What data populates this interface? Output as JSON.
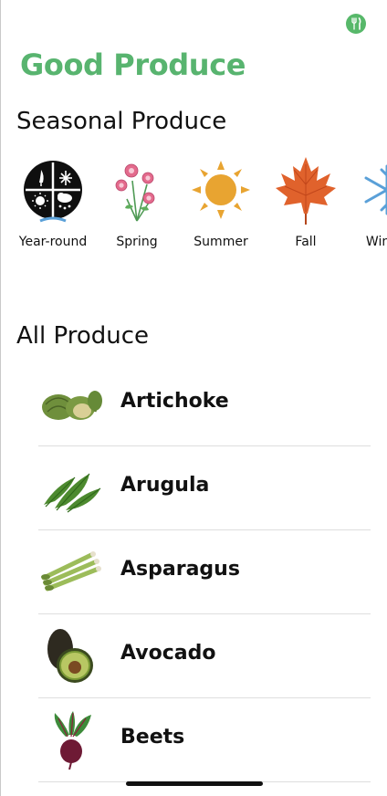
{
  "app": {
    "title": "Good Produce"
  },
  "top_icon": {
    "name": "fork-knife-icon"
  },
  "seasonal": {
    "title": "Seasonal Produce",
    "items": [
      {
        "label": "Year-round",
        "icon": "four-seasons-icon"
      },
      {
        "label": "Spring",
        "icon": "flowers-icon"
      },
      {
        "label": "Summer",
        "icon": "sun-icon"
      },
      {
        "label": "Fall",
        "icon": "maple-leaf-icon"
      },
      {
        "label": "Winter",
        "icon": "snowflake-icon"
      }
    ]
  },
  "all_produce": {
    "title": "All Produce",
    "items": [
      {
        "name": "Artichoke",
        "image": "artichoke-image"
      },
      {
        "name": "Arugula",
        "image": "arugula-image"
      },
      {
        "name": "Asparagus",
        "image": "asparagus-image"
      },
      {
        "name": "Avocado",
        "image": "avocado-image"
      },
      {
        "name": "Beets",
        "image": "beets-image"
      }
    ]
  },
  "colors": {
    "accent": "#58b46f",
    "text": "#111111",
    "separator": "#dedede"
  }
}
